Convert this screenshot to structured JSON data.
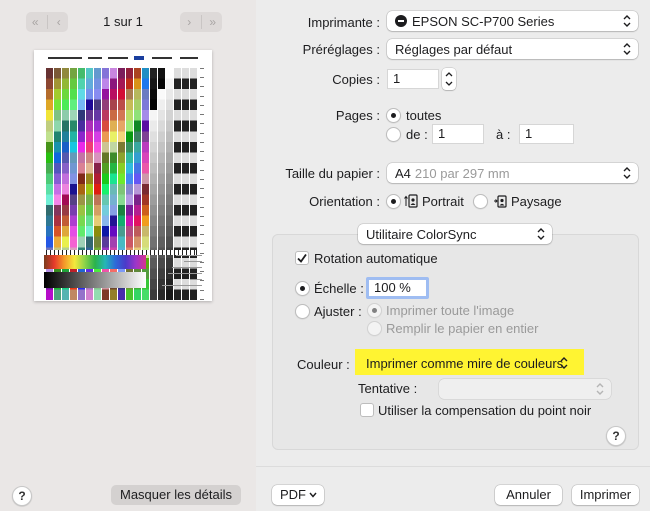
{
  "preview": {
    "page_count": "1 sur 1",
    "first_prev_icons": [
      "«",
      "‹"
    ],
    "next_last_icons": [
      "›",
      "»"
    ],
    "hide_details_label": "Masquer les détails",
    "help_label": "?"
  },
  "printer": {
    "label": "Imprimante :",
    "value": "EPSON SC-P700 Series"
  },
  "presets": {
    "label": "Préréglages :",
    "value": "Réglages par défaut"
  },
  "copies": {
    "label": "Copies :",
    "value": "1"
  },
  "pages": {
    "label": "Pages :",
    "all_label": "toutes",
    "from_label": "de :",
    "to_label": "à :",
    "from_value": "1",
    "to_value": "1"
  },
  "paper_size": {
    "label": "Taille du papier :",
    "value": "A4",
    "dims": "210 par 297 mm"
  },
  "orientation": {
    "label": "Orientation :",
    "portrait_label": "Portrait",
    "landscape_label": "Paysage"
  },
  "section": {
    "value": "Utilitaire ColorSync"
  },
  "colorsync": {
    "auto_rotate_label": "Rotation automatique",
    "scale_label": "Échelle :",
    "scale_value": "100 %",
    "fit_label": "Ajuster :",
    "fit_print_label": "Imprimer toute l'image",
    "fit_fill_label": "Remplir le papier en entier",
    "color_label": "Couleur :",
    "color_value": "Imprimer comme mire de couleurs",
    "attempt_label": "Tentative :",
    "attempt_value": "",
    "black_point_label": "Utiliser la compensation du point noir",
    "help_label": "?"
  },
  "footer": {
    "pdf_label": "PDF",
    "cancel_label": "Annuler",
    "print_label": "Imprimer"
  },
  "colors": {
    "highlight": "#fff432",
    "accent": "#2f6fdf",
    "sidebar_bg": "#eae7e6"
  }
}
